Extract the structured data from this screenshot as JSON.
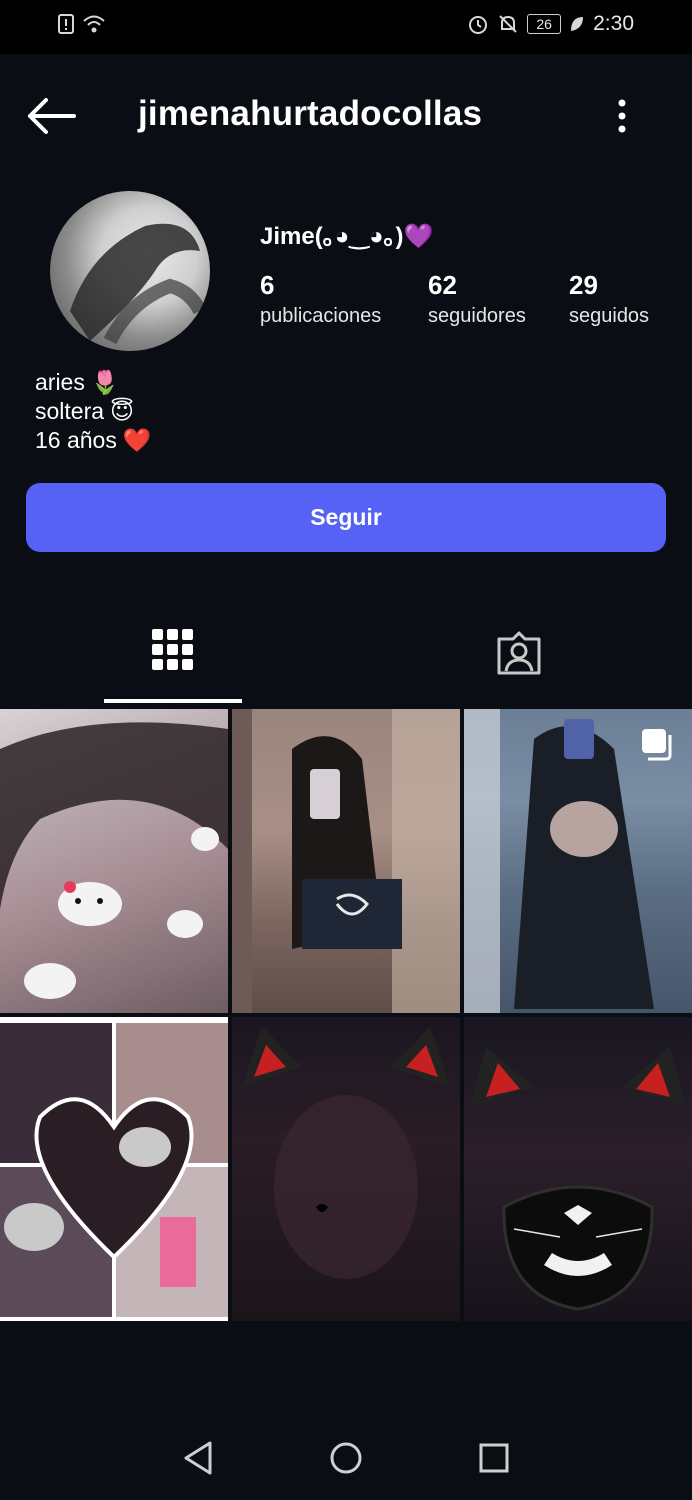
{
  "status_bar": {
    "battery_level": "26",
    "time": "2:30"
  },
  "header": {
    "username": "jimenahurtadocollas"
  },
  "profile": {
    "display_name": "Jime(｡◕‿◕｡)💜",
    "stats": [
      {
        "value": "6",
        "label": "publicaciones"
      },
      {
        "value": "62",
        "label": "seguidores"
      },
      {
        "value": "29",
        "label": "seguidos"
      }
    ],
    "bio_lines": [
      {
        "text": "aries",
        "emoji": "🌷"
      },
      {
        "text": "soltera",
        "emoji": "😇"
      },
      {
        "text": "16 años",
        "emoji": "❤️"
      }
    ]
  },
  "actions": {
    "follow_label": "Seguir"
  },
  "tabs": {
    "active": "grid",
    "items": [
      "grid",
      "tagged"
    ]
  },
  "colors": {
    "background": "#0b0d14",
    "accent": "#5661f6",
    "text": "#ffffff"
  },
  "posts_count_visible": 6,
  "icons": [
    "back-arrow-icon",
    "more-vertical-icon",
    "grid-icon",
    "tagged-person-icon",
    "multiple-images-icon",
    "nav-back-icon",
    "nav-home-icon",
    "nav-recents-icon"
  ]
}
